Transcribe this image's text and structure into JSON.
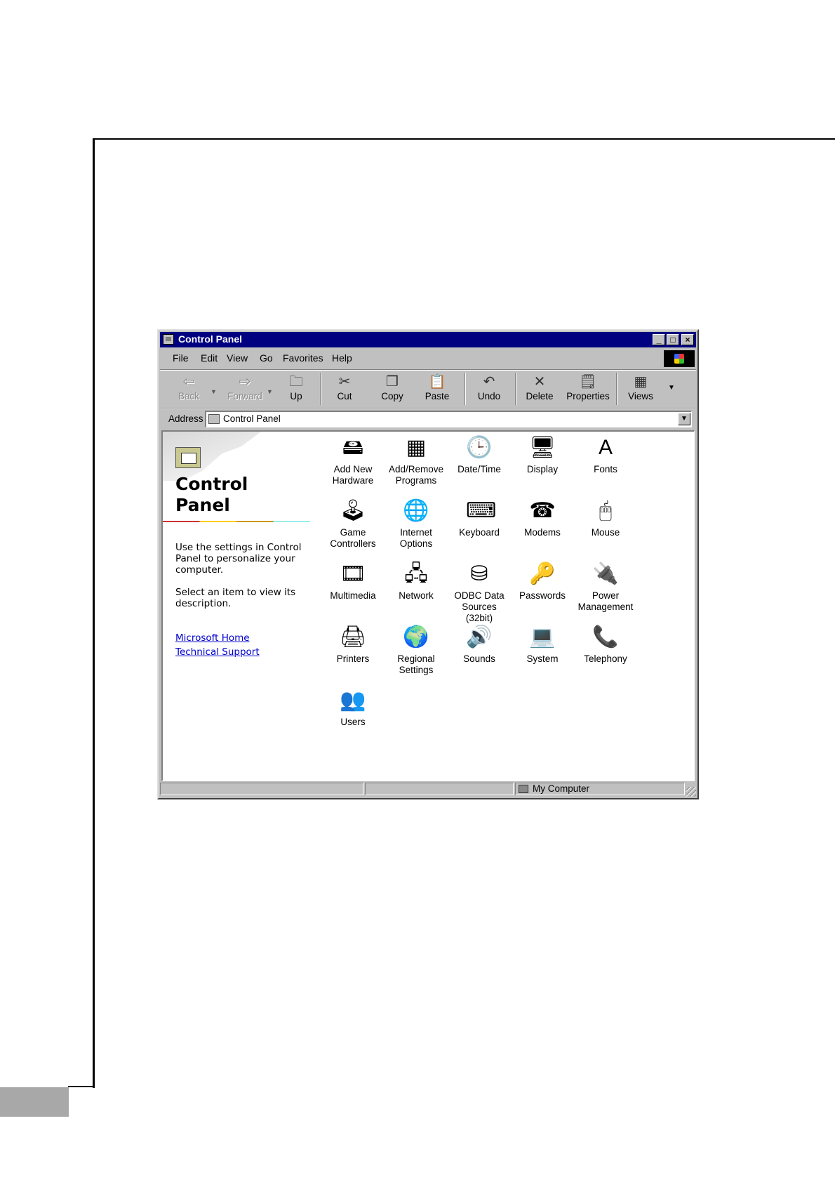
{
  "window": {
    "title": "Control Panel",
    "controls": {
      "minimize": "_",
      "maximize": "□",
      "close": "×"
    }
  },
  "menu": [
    {
      "label": "File"
    },
    {
      "label": "Edit"
    },
    {
      "label": "View"
    },
    {
      "label": "Go"
    },
    {
      "label": "Favorites"
    },
    {
      "label": "Help"
    }
  ],
  "toolbar": {
    "back": {
      "label": "Back",
      "icon": "back-arrow-icon",
      "enabled": false
    },
    "forward": {
      "label": "Forward",
      "icon": "forward-arrow-icon",
      "enabled": false
    },
    "up": {
      "label": "Up",
      "icon": "folder-up-icon"
    },
    "cut": {
      "label": "Cut",
      "icon": "scissors-icon"
    },
    "copy": {
      "label": "Copy",
      "icon": "copy-icon"
    },
    "paste": {
      "label": "Paste",
      "icon": "paste-icon"
    },
    "undo": {
      "label": "Undo",
      "icon": "undo-icon"
    },
    "delete": {
      "label": "Delete",
      "icon": "delete-x-icon"
    },
    "properties": {
      "label": "Properties",
      "icon": "properties-icon"
    },
    "views": {
      "label": "Views",
      "icon": "views-grid-icon"
    }
  },
  "address": {
    "label": "Address",
    "value": "Control Panel"
  },
  "left_pane": {
    "title_line1": "Control",
    "title_line2": "Panel",
    "description": "Use the settings in Control Panel to personalize your computer.",
    "hint": "Select an item to view its description.",
    "links": [
      "Microsoft Home",
      "Technical Support"
    ]
  },
  "items": [
    {
      "line1": "Add New",
      "line2": "Hardware",
      "icon": "add-hardware-icon"
    },
    {
      "line1": "Add/Remove",
      "line2": "Programs",
      "icon": "add-remove-programs-icon"
    },
    {
      "line1": "Date/Time",
      "line2": "",
      "icon": "date-time-icon"
    },
    {
      "line1": "Display",
      "line2": "",
      "icon": "display-icon"
    },
    {
      "line1": "Fonts",
      "line2": "",
      "icon": "fonts-folder-icon"
    },
    {
      "line1": "Game",
      "line2": "Controllers",
      "icon": "joystick-icon"
    },
    {
      "line1": "Internet",
      "line2": "Options",
      "icon": "internet-globe-icon"
    },
    {
      "line1": "Keyboard",
      "line2": "",
      "icon": "keyboard-icon"
    },
    {
      "line1": "Modems",
      "line2": "",
      "icon": "modem-phone-icon"
    },
    {
      "line1": "Mouse",
      "line2": "",
      "icon": "mouse-icon"
    },
    {
      "line1": "Multimedia",
      "line2": "",
      "icon": "multimedia-icon"
    },
    {
      "line1": "Network",
      "line2": "",
      "icon": "network-icon"
    },
    {
      "line1": "ODBC Data",
      "line2": "Sources (32bit)",
      "icon": "odbc-icon"
    },
    {
      "line1": "Passwords",
      "line2": "",
      "icon": "keys-icon"
    },
    {
      "line1": "Power",
      "line2": "Management",
      "icon": "power-plug-icon"
    },
    {
      "line1": "Printers",
      "line2": "",
      "icon": "printer-folder-icon"
    },
    {
      "line1": "Regional",
      "line2": "Settings",
      "icon": "globe-icon"
    },
    {
      "line1": "Sounds",
      "line2": "",
      "icon": "speaker-icon"
    },
    {
      "line1": "System",
      "line2": "",
      "icon": "computer-icon"
    },
    {
      "line1": "Telephony",
      "line2": "",
      "icon": "telephony-icon"
    },
    {
      "line1": "Users",
      "line2": "",
      "icon": "users-icon"
    }
  ],
  "statusbar": {
    "zone": "My Computer"
  }
}
